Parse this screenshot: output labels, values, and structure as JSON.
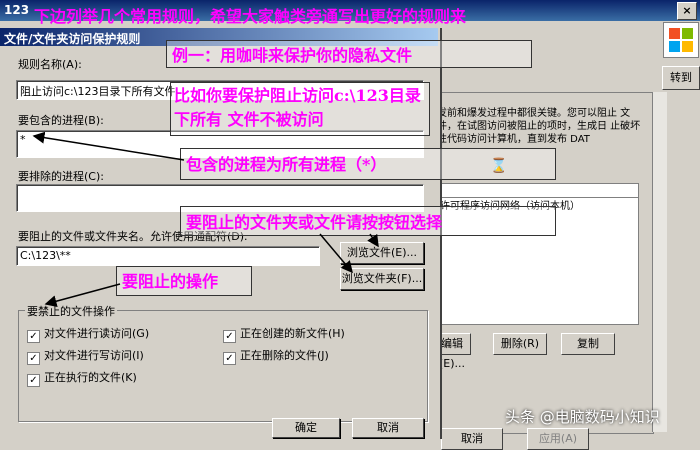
{
  "background_window": {
    "title": "123",
    "close_label": "×",
    "goto_label": "转到",
    "description": "发前和爆发过程中都很关键。您可以阻止 文件，在试图访问被阻止的项时，生成日 止破坏性代码访问计算机，直到发布 DAT",
    "list_header": "许可程序访问网络（访问本机）",
    "buttons": {
      "edit": "编辑(E)...",
      "delete": "删除(R)",
      "copy": "复制",
      "apply": "应用(A)",
      "cancel": "取消"
    }
  },
  "dialog": {
    "title": "文件/文件夹访问保护规则",
    "rule_name_label": "规则名称(A):",
    "rule_name_value": "阻止访问c:\\123目录下所有文件",
    "include_process_label": "要包含的进程(B):",
    "include_process_value": "*",
    "exclude_process_label": "要排除的进程(C):",
    "exclude_process_value": "",
    "target_label": "要阻止的文件或文件夹名。允许使用通配符(D).",
    "target_value": "C:\\123\\**",
    "browse_file_button": "浏览文件(E)...",
    "browse_folder_button": "浏览文件夹(F)...",
    "actions_group_label": "要禁止的文件操作",
    "checkboxes": {
      "read": {
        "label": "对文件进行读访问(G)",
        "checked": true
      },
      "write": {
        "label": "对文件进行写访问(I)",
        "checked": true
      },
      "execute": {
        "label": "正在执行的文件(K)",
        "checked": true
      },
      "create": {
        "label": "正在创建的新文件(H)",
        "checked": true
      },
      "delete": {
        "label": "正在删除的文件(J)",
        "checked": true
      }
    },
    "check_mark": "✓",
    "ok_button": "确定",
    "cancel_button": "取消"
  },
  "annotations": {
    "top_banner": "下边列举几个常用规则，希望大家触类旁通写出更好的规则来",
    "example_one": "例一：用咖啡来保护你的隐私文件",
    "example_detail": "比如你要保护阻止访问c:\\123目录下所有 文件不被访问",
    "include_all": "包含的进程为所有进程（*）",
    "select_target": "要阻止的文件夹或文件请按按钮选择",
    "block_actions": "要阻止的操作"
  },
  "watermark": "头条 @电脑数码小知识"
}
